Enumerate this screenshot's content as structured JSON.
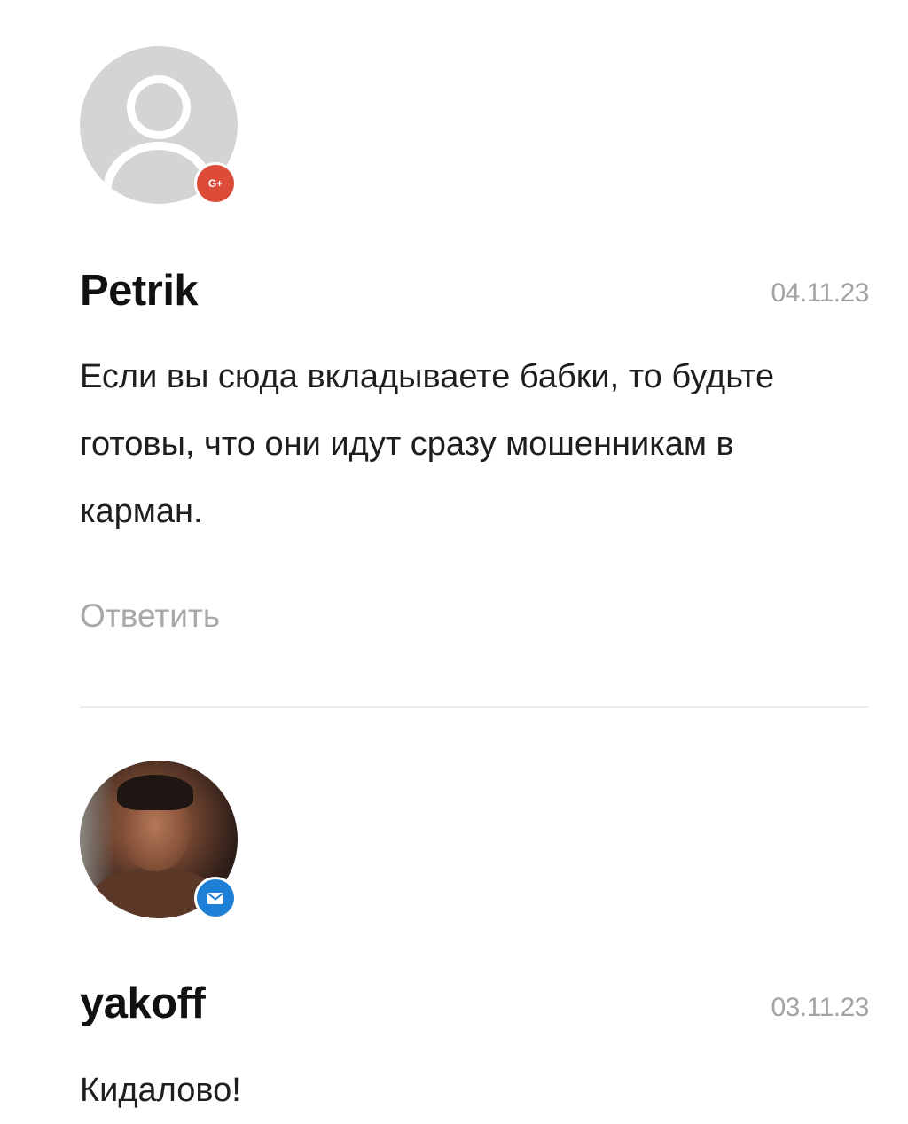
{
  "comments": [
    {
      "author": "Petrik",
      "date": "04.11.23",
      "text": "Если вы сюда вкладываете бабки, то будьте готовы, что они идут сразу мошенникам в карман.",
      "reply_label": "Ответить",
      "avatar": "default-user-avatar",
      "badge_icon": "google-plus-icon",
      "badge_label": "G+",
      "badge_color": "#dd4b39"
    },
    {
      "author": "yakoff",
      "date": "03.11.23",
      "text": "Кидалово!",
      "avatar": "user-photo-avatar",
      "badge_icon": "mail-icon",
      "badge_color": "#1d7fd6"
    }
  ],
  "colors": {
    "author": "#111111",
    "date": "#a3a3a3",
    "reply": "#a8a8a8",
    "divider": "#ececec"
  }
}
